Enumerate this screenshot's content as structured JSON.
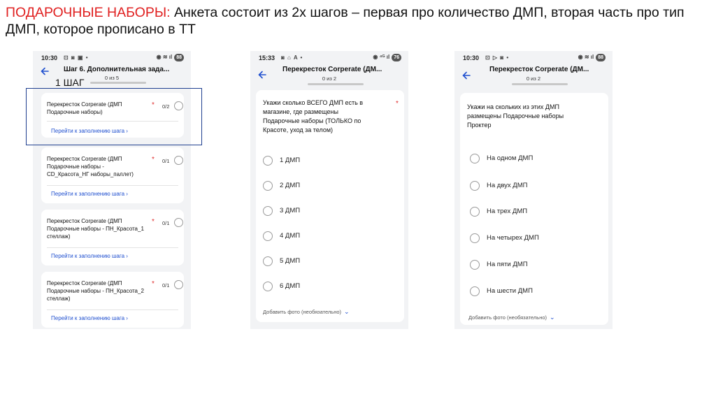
{
  "slide": {
    "title_lead": "ПОДАРОЧНЫЕ НАБОРЫ:",
    "title_rest": " Анкета состоит из 2х шагов – первая про количество ДМП, вторая часть про тип ДМП, которое прописано в ТТ"
  },
  "annotation": {
    "label": "1 ШАГ"
  },
  "phone1": {
    "status": {
      "time": "10:30",
      "icons": "⊡ ◙ ▣ •",
      "right_icons": "◉ ≋ ıl",
      "battery": "88"
    },
    "title": "Шаг 6. Дополнительная зада...",
    "steps": "0 из 5",
    "items": [
      {
        "title": "Перекресток Corperate (ДМП Подарочные наборы)",
        "required": "*",
        "count": "0/2",
        "link": "Перейти к заполнению шага ›"
      },
      {
        "title": "Перекресток Corperate (ДМП Подарочные наборы - CD_Красота_НГ наборы_паллет)",
        "required": "*",
        "count": "0/1",
        "link": "Перейти к заполнению шага ›"
      },
      {
        "title": "Перекресток Corperate (ДМП Подарочные наборы - ПН_Красота_1 стеллаж)",
        "required": "*",
        "count": "0/1",
        "link": "Перейти к заполнению шага ›"
      },
      {
        "title": "Перекресток Corperate (ДМП Подарочные наборы - ПН_Красота_2 стеллаж)",
        "required": "*",
        "count": "0/1",
        "link": "Перейти к заполнению шага ›"
      }
    ]
  },
  "phone2": {
    "status": {
      "time": "15:33",
      "icons": "◙ ⌂ A •",
      "right_icons": "◉ ⁴ᴳ ıl",
      "battery": "76"
    },
    "title": "Перекресток Corperate (ДМ...",
    "steps": "0 из 2",
    "question": "Укажи сколько ВСЕГО ДМП есть в магазине, где размещены Подарочные наборы (ТОЛЬКО по Красоте, уход за телом)",
    "required": "*",
    "options": [
      "1 ДМП",
      "2 ДМП",
      "3 ДМП",
      "4 ДМП",
      "5 ДМП",
      "6 ДМП"
    ],
    "add_photo": "Добавить фото (необязательно)"
  },
  "phone3": {
    "status": {
      "time": "10:30",
      "icons": "⊡ ▷ ◙ •",
      "right_icons": "◉ ≋ ıl",
      "battery": "88"
    },
    "title": "Перекресток Corperate (ДМ...",
    "steps": "0 из 2",
    "question": "Укажи на скольких из этих ДМП размещены Подарочные наборы Проктер",
    "required": "*",
    "options": [
      "На одном ДМП",
      "На двух ДМП",
      "На трех ДМП",
      "На четырех ДМП",
      "На пяти ДМП",
      "На шести ДМП"
    ],
    "add_photo": "Добавить фото (необязательно)"
  },
  "icons": {
    "back": "arrow-left-icon",
    "chevron": "chevron-down-icon",
    "accent": "#1f4fcf",
    "required_color": "#e03030",
    "title_color": "#e02020"
  }
}
